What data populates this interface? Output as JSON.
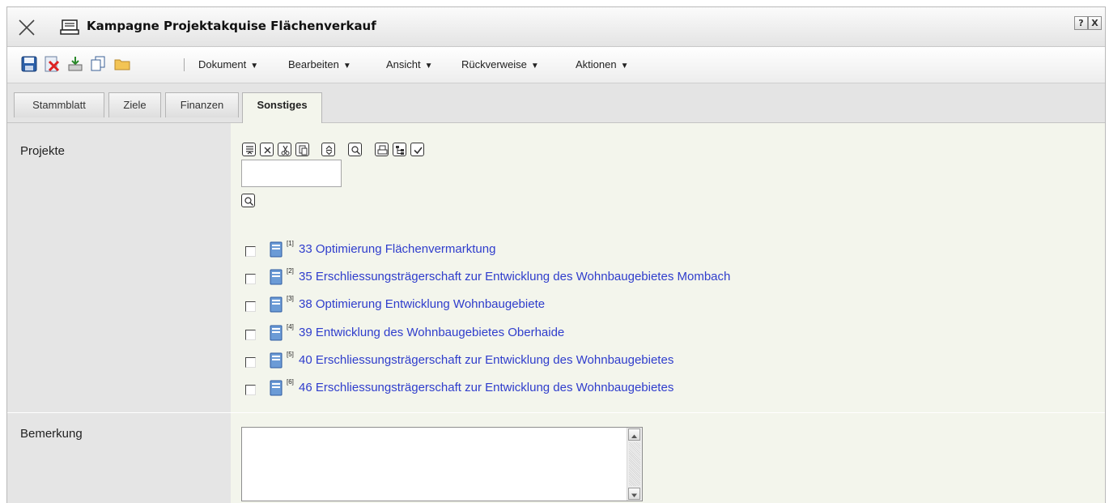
{
  "window": {
    "title": "Kampagne Projektakquise Flächenverkauf",
    "help_button": "?",
    "close_button": "X"
  },
  "toolbar": {
    "icons": [
      "save-icon",
      "delete-icon",
      "export-icon",
      "copy-icon",
      "folder-icon"
    ],
    "menus": [
      {
        "label": "Dokument"
      },
      {
        "label": "Bearbeiten"
      },
      {
        "label": "Ansicht"
      },
      {
        "label": "Rückverweise"
      },
      {
        "label": "Aktionen"
      }
    ]
  },
  "tabs": [
    {
      "label": "Stammblatt",
      "active": false
    },
    {
      "label": "Ziele",
      "active": false
    },
    {
      "label": "Finanzen",
      "active": false
    },
    {
      "label": "Sonstiges",
      "active": true
    }
  ],
  "fields": {
    "projekte_label": "Projekte",
    "bemerkung_label": "Bemerkung",
    "search_value": "",
    "bemerkung_value": ""
  },
  "projekte_controls": [
    "list-icon",
    "remove-icon",
    "cut-icon",
    "paste-icon",
    "sort-icon",
    "search-icon",
    "print-icon",
    "tree-icon",
    "check-icon"
  ],
  "projects": [
    {
      "index": "[1]",
      "label": "33 Optimierung Flächenvermarktung"
    },
    {
      "index": "[2]",
      "label": "35 Erschliessungsträgerschaft zur Entwicklung des Wohnbaugebietes Mombach"
    },
    {
      "index": "[3]",
      "label": "38 Optimierung Entwicklung Wohnbaugebiete"
    },
    {
      "index": "[4]",
      "label": "39 Entwicklung des Wohnbaugebietes Oberhaide"
    },
    {
      "index": "[5]",
      "label": "40 Erschliessungsträgerschaft zur Entwicklung des Wohnbaugebietes"
    },
    {
      "index": "[6]",
      "label": "46 Erschliessungsträgerschaft zur Entwicklung des Wohnbaugebietes"
    }
  ],
  "colors": {
    "link": "#2f3dcc",
    "content_bg": "#f3f5ec",
    "label_bg": "#e5e5e5"
  }
}
